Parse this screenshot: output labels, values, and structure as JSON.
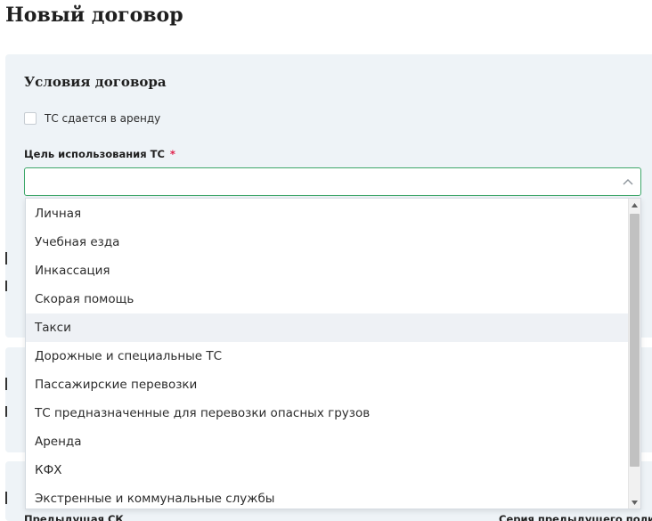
{
  "page": {
    "title": "Новый договор"
  },
  "contract_conditions": {
    "title": "Условия договора",
    "rental_checkbox": {
      "label": "ТС сдается в аренду",
      "checked": false
    },
    "usage_purpose": {
      "label": "Цель использования ТС",
      "required_mark": "*",
      "value": ""
    }
  },
  "usage_options": [
    "Личная",
    "Учебная езда",
    "Инкассация",
    "Скорая помощь",
    "Такси",
    "Дорожные и специальные ТС",
    "Пассажирские перевозки",
    "ТС предназначенные для перевозки опасных грузов",
    "Аренда",
    "КФХ",
    "Экстренные и коммунальные службы"
  ],
  "highlighted_option": "Такси",
  "scroll_position": 0,
  "footer_labels": {
    "previous_insurer": "Предыдущая СК",
    "previous_policy_series": "Серия предыдущего полиса"
  },
  "colors": {
    "section_background": "#eef3f7",
    "select_border_focus": "#3ea76a",
    "required_mark": "#e11d48",
    "highlight_background": "#eef1f5"
  }
}
